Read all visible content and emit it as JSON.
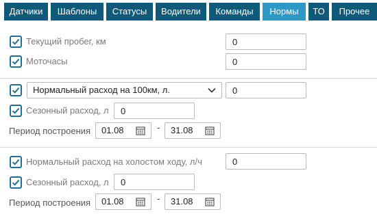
{
  "tabs": [
    {
      "label": "Датчики"
    },
    {
      "label": "Шаблоны"
    },
    {
      "label": "Статусы"
    },
    {
      "label": "Водители"
    },
    {
      "label": "Команды"
    },
    {
      "label": "Нормы"
    },
    {
      "label": "ТО"
    },
    {
      "label": "Прочее"
    }
  ],
  "active_tab": "Нормы",
  "mileage": {
    "label": "Текущий пробег, км",
    "checked": true,
    "value": "0"
  },
  "engine_hours": {
    "label": "Моточасы",
    "checked": true,
    "value": "0"
  },
  "normal_consumption": {
    "checked": true,
    "selected": "Нормальный расход на 100км, л.",
    "value": "0",
    "seasonal": {
      "label": "Сезонный расход, л",
      "checked": true,
      "value": "0"
    },
    "period": {
      "label": "Период построения",
      "from": "01.08",
      "dash": "-",
      "to": "31.08"
    }
  },
  "idle_consumption": {
    "label": "Нормальный расход на холостом ходу, л/ч",
    "checked": true,
    "value": "0",
    "seasonal": {
      "label": "Сезонный расход, л",
      "checked": true,
      "value": "0"
    },
    "period": {
      "label": "Период построения",
      "from": "01.08",
      "dash": "-",
      "to": "31.08"
    }
  },
  "colors": {
    "tab_bg": "#0e5a78",
    "tab_active": "#2b98c6",
    "checkbox": "#1e6f97"
  }
}
